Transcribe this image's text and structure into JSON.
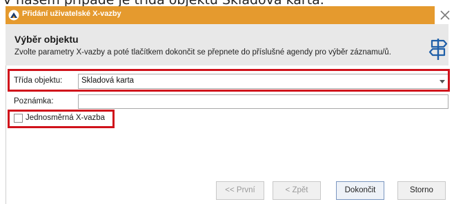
{
  "caption": "V našem případě je třída objektu Skladová karta.",
  "window": {
    "title": "Přidání uživatelské X-vazby",
    "close_label": "×"
  },
  "header": {
    "title": "Výběr objektu",
    "description": "Zvolte parametry X-vazby a poté tlačítkem dokončit se přepnete do příslušné agendy pro výběr záznamu/ů."
  },
  "form": {
    "trida_label": "Třída objektu:",
    "trida_value": "Skladová karta",
    "poznamka_label": "Poznámka:",
    "poznamka_value": "",
    "jednosmerna_label": "Jednosměrná X-vazba",
    "jednosmerna_checked": false
  },
  "buttons": {
    "prvni": "<< První",
    "zpet": "< Zpět",
    "dokoncit": "Dokončit",
    "storno": "Storno"
  },
  "colors": {
    "titlebar": "#e59a2e",
    "highlight": "#d0121b",
    "header_band": "#e8e8e8"
  }
}
